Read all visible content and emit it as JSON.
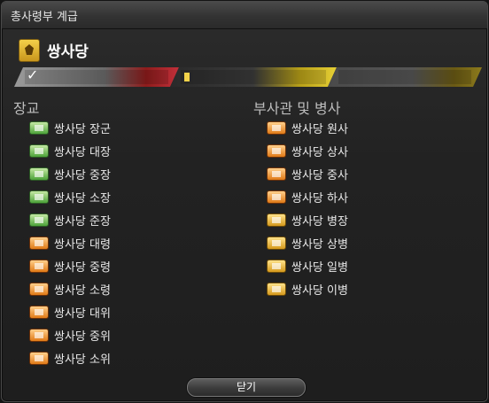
{
  "window": {
    "title": "총사령부 계급"
  },
  "company": {
    "name": "쌍사당",
    "emblem_icon": "serpent-emblem-icon",
    "accent": "#e6c53a"
  },
  "rank_tiers": {
    "completed_mark": "✓"
  },
  "officers": {
    "heading": "장교",
    "ranks": [
      {
        "label": "쌍사당 장군",
        "icon": "green-insignia-icon"
      },
      {
        "label": "쌍사당 대장",
        "icon": "green-insignia-icon"
      },
      {
        "label": "쌍사당 중장",
        "icon": "green-insignia-icon"
      },
      {
        "label": "쌍사당 소장",
        "icon": "green-insignia-icon"
      },
      {
        "label": "쌍사당 준장",
        "icon": "green-insignia-icon"
      },
      {
        "label": "쌍사당 대령",
        "icon": "orange-insignia-icon"
      },
      {
        "label": "쌍사당 중령",
        "icon": "orange-insignia-icon"
      },
      {
        "label": "쌍사당 소령",
        "icon": "orange-insignia-icon"
      },
      {
        "label": "쌍사당 대위",
        "icon": "orange-bar-insignia-icon"
      },
      {
        "label": "쌍사당 중위",
        "icon": "orange-bar-insignia-icon"
      },
      {
        "label": "쌍사당 소위",
        "icon": "orange-bar-insignia-icon"
      }
    ]
  },
  "enlisted": {
    "heading": "부사관 및 병사",
    "ranks": [
      {
        "label": "쌍사당 원사",
        "icon": "orange-chevron-insignia-icon"
      },
      {
        "label": "쌍사당 상사",
        "icon": "orange-chevron-insignia-icon"
      },
      {
        "label": "쌍사당 중사",
        "icon": "orange-chevron-insignia-icon"
      },
      {
        "label": "쌍사당 하사",
        "icon": "orange-chevron-insignia-icon"
      },
      {
        "label": "쌍사당 병장",
        "icon": "gold-insignia-icon"
      },
      {
        "label": "쌍사당 상병",
        "icon": "gold-insignia-icon"
      },
      {
        "label": "쌍사당 일병",
        "icon": "gold-insignia-icon"
      },
      {
        "label": "쌍사당 이병",
        "icon": "gold-insignia-icon"
      }
    ]
  },
  "footer": {
    "close_label": "닫기"
  }
}
